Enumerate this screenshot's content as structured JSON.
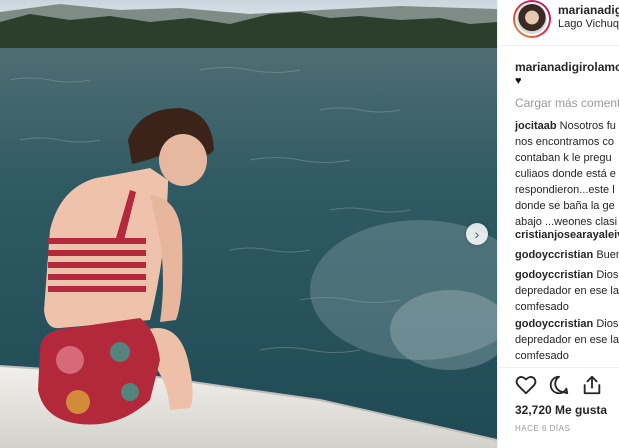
{
  "post": {
    "username": "marianadigirolamo",
    "username_short": "marianadigi",
    "location": "Lago Vichuquén",
    "location_short": "Lago Vichuqu"
  },
  "caption": {
    "username": "marianadigirolamo",
    "text": "♥"
  },
  "load_more_label": "Cargar más comentarios",
  "load_more_short": "Cargar más comenta",
  "comments": [
    {
      "username": "jocitaab",
      "lines": [
        "Nosotros fu",
        "nos encontramos co",
        "contaban k le pregu",
        "culiaos donde está e",
        "respondieron...este l",
        "donde se baña la ge",
        "abajo ...weones clasi"
      ]
    },
    {
      "username": "cristianjosearayaleiv",
      "lines": [
        ""
      ]
    },
    {
      "username": "godoyccristian",
      "lines": [
        "Buen"
      ]
    },
    {
      "username": "godoyccristian",
      "lines": [
        "Dios",
        "depredador en ese la",
        "comfesado"
      ]
    },
    {
      "username": "godoyccristian",
      "lines": [
        "Dios",
        "depredador en ese la",
        "comfesado"
      ]
    }
  ],
  "likes_label": "32,720 Me gusta",
  "time_label": "HACE 6 DÍAS",
  "icons": {
    "like": "heart-icon",
    "comment": "comment-icon",
    "share": "share-icon",
    "next": "chevron-right-icon"
  },
  "colors": {
    "text": "#262626",
    "muted": "#999999",
    "water": "#2f5560",
    "swimsuit": "#b3283a"
  }
}
